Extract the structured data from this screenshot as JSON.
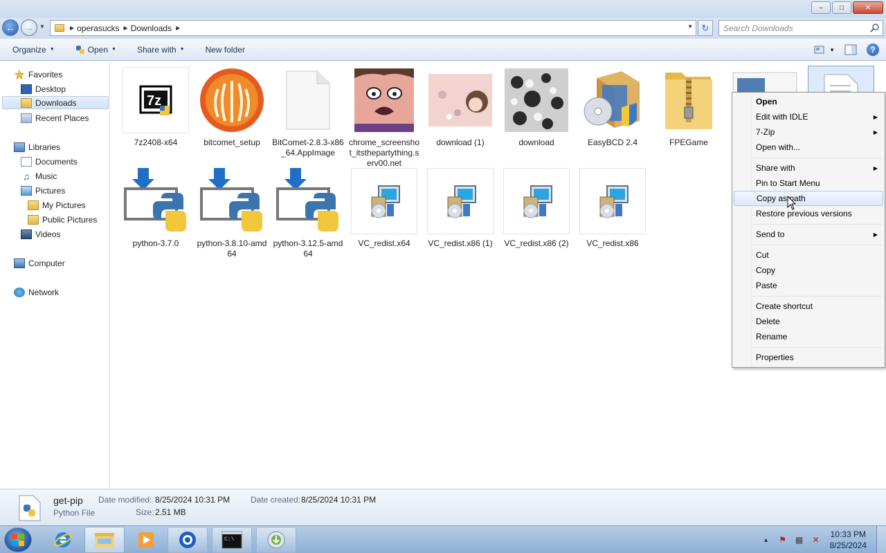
{
  "window": {
    "min": "–",
    "max": "□",
    "close": "✕"
  },
  "address": {
    "crumbs": [
      "operasucks",
      "Downloads"
    ]
  },
  "search": {
    "placeholder": "Search Downloads"
  },
  "toolbar": {
    "organize": "Organize",
    "open": "Open",
    "share_with": "Share with",
    "new_folder": "New folder"
  },
  "nav": {
    "favorites": "Favorites",
    "desktop": "Desktop",
    "downloads": "Downloads",
    "recent": "Recent Places",
    "libraries": "Libraries",
    "documents": "Documents",
    "music": "Music",
    "pictures": "Pictures",
    "my_pictures": "My Pictures",
    "public_pictures": "Public Pictures",
    "videos": "Videos",
    "computer": "Computer",
    "network": "Network"
  },
  "files": [
    {
      "label": "7z2408-x64",
      "icon": "7zip-installer-icon"
    },
    {
      "label": "bitcomet_setup",
      "icon": "bitcomet-icon"
    },
    {
      "label": "BitComet-2.8.3-x86_64.AppImage",
      "icon": "blank-file-icon"
    },
    {
      "label": "chrome_screenshot_itsthepartything.serv00.net",
      "icon": "image-thumbnail"
    },
    {
      "label": "download (1)",
      "icon": "image-thumbnail"
    },
    {
      "label": "download",
      "icon": "image-thumbnail"
    },
    {
      "label": "EasyBCD 2.4",
      "icon": "installer-box-icon"
    },
    {
      "label": "FPEGame",
      "icon": "zip-folder-icon"
    },
    {
      "label": "python-3.7.0",
      "icon": "python-installer-icon"
    },
    {
      "label": "python-3.8.10-amd64",
      "icon": "python-installer-icon"
    },
    {
      "label": "python-3.12.5-amd64",
      "icon": "python-installer-icon"
    },
    {
      "label": "VC_redist.x64",
      "icon": "msi-installer-icon"
    },
    {
      "label": "VC_redist.x86 (1)",
      "icon": "msi-installer-icon"
    },
    {
      "label": "VC_redist.x86 (2)",
      "icon": "msi-installer-icon"
    },
    {
      "label": "VC_redist.x86",
      "icon": "msi-installer-icon"
    }
  ],
  "context_menu": {
    "open": "Open",
    "edit_idle": "Edit with IDLE",
    "seven_zip": "7-Zip",
    "open_with": "Open with...",
    "share_with": "Share with",
    "pin_start": "Pin to Start Menu",
    "copy_as_path": "Copy as path",
    "restore": "Restore previous versions",
    "send_to": "Send to",
    "cut": "Cut",
    "copy": "Copy",
    "paste": "Paste",
    "create_shortcut": "Create shortcut",
    "delete": "Delete",
    "rename": "Rename",
    "properties": "Properties"
  },
  "details": {
    "name": "get-pip",
    "type": "Python File",
    "modified_label": "Date modified:",
    "modified": "8/25/2024 10:31 PM",
    "created_label": "Date created:",
    "created": "8/25/2024 10:31 PM",
    "size_label": "Size:",
    "size": "2.51 MB"
  },
  "taskbar": {
    "time": "10:33 PM",
    "date": "8/25/2024"
  }
}
